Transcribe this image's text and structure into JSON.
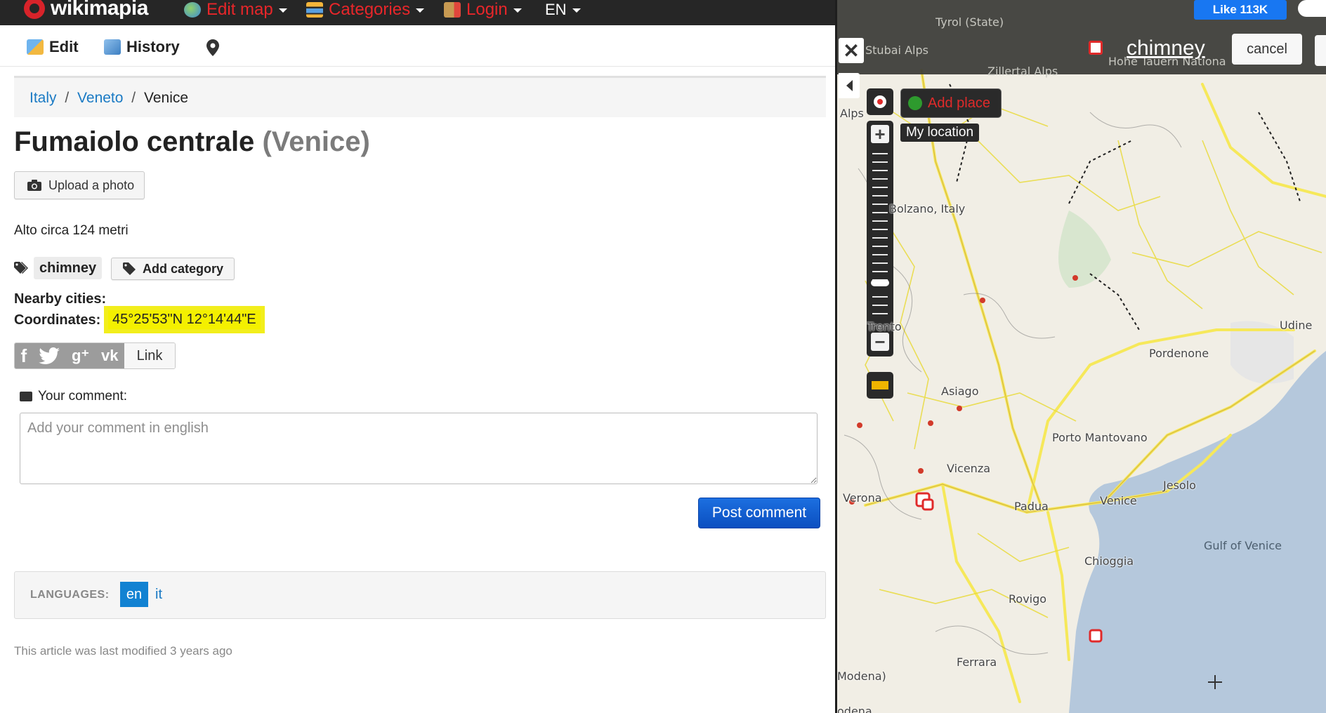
{
  "topbar": {
    "logo_text": "wikimapia",
    "menu": [
      {
        "label": "Edit map"
      },
      {
        "label": "Categories"
      },
      {
        "label": "Login"
      },
      {
        "label": "EN"
      }
    ]
  },
  "toolbar": {
    "edit_label": "Edit",
    "history_label": "History"
  },
  "breadcrumb": {
    "items": [
      "Italy",
      "Veneto",
      "Venice"
    ],
    "sep": "/"
  },
  "place": {
    "title": "Fumaiolo centrale",
    "subtitle": "(Venice)",
    "upload_label": "Upload a photo",
    "description": "Alto circa 124 metri",
    "category": "chimney",
    "add_category_label": "Add category",
    "nearby_label": "Nearby cities:",
    "coords_label": "Coordinates:",
    "coords_value": "45°25'53\"N 12°14'44\"E",
    "link_label": "Link"
  },
  "comment": {
    "label": "Your comment:",
    "placeholder": "Add your comment in english",
    "post_label": "Post comment"
  },
  "languages": {
    "heading": "LANGUAGES:",
    "items": [
      "en",
      "it"
    ],
    "active": "en"
  },
  "footer": {
    "modified": "This article was last modified 3 years ago"
  },
  "map": {
    "fb_like": "Like 113K",
    "category_label": "chimney",
    "cancel_label": "cancel",
    "add_place_label": "Add place",
    "my_location_label": "My location",
    "labels": {
      "tyrol": "Tyrol (State)",
      "stubai": "Stubai Alps",
      "zillertal": "Zillertal Alps",
      "hohe": "Hohe Tauern Nationa",
      "alps": "Alps",
      "bolzano": "Bolzano, Italy",
      "trento": "Trento",
      "asiago": "Asiago",
      "udine": "Udine",
      "pordenone": "Pordenone",
      "porto_mantovano": "Porto Mantovano",
      "vicenza": "Vicenza",
      "verona": "Verona",
      "padua": "Padua",
      "venice": "Venice",
      "jesolo": "Jesolo",
      "gulf": "Gulf of Venice",
      "chioggia": "Chioggia",
      "rovigo": "Rovigo",
      "ferrara": "Ferrara",
      "modena": "Modena)",
      "modena2": "odena"
    }
  },
  "colors": {
    "accent_red": "#e8262a",
    "link_blue": "#1a7ac4",
    "post_button": "#0b4fc0",
    "highlight": "#f4f000",
    "sea": "#b5c8dc",
    "roads": "#f6e85a"
  }
}
